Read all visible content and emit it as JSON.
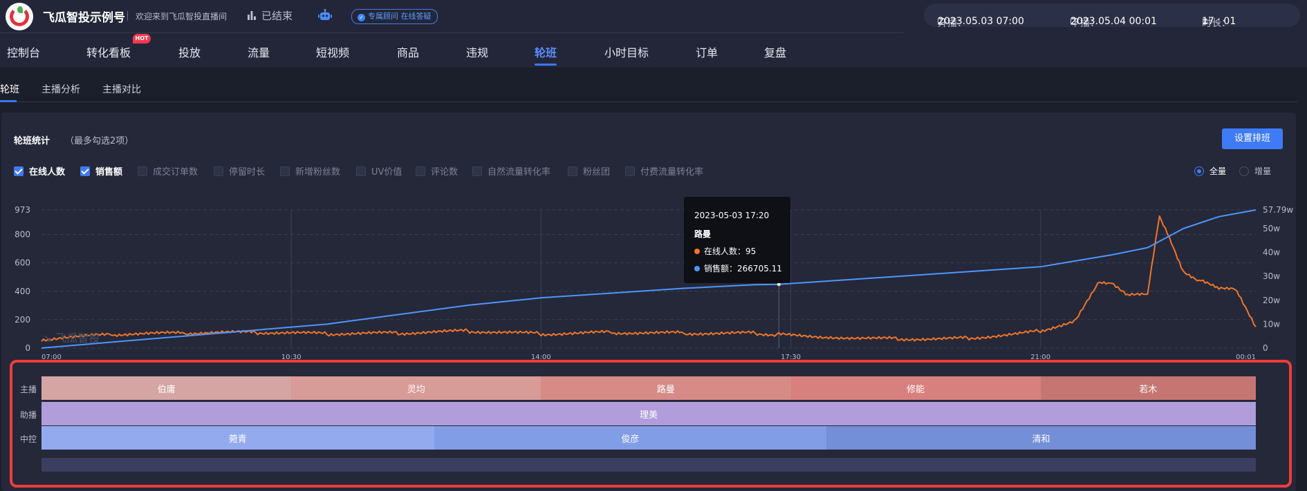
{
  "header": {
    "brand": "飞瓜智投示例号",
    "welcome": "欢迎来到飞瓜智投直播间",
    "status": "已结束",
    "consult": "专属顾问 在线答疑",
    "start_label": "开播：",
    "start_time": "2023.05.03 07:00",
    "end_label": "下播：",
    "end_time": "2023.05.04 00:01",
    "duration_label": "时长：",
    "duration": "17 : 01"
  },
  "nav": {
    "items": [
      "控制台",
      "转化看板",
      "投放",
      "流量",
      "短视频",
      "商品",
      "违规",
      "轮班",
      "小时目标",
      "订单",
      "复盘"
    ],
    "hot_badge": "HOT",
    "active": "轮班"
  },
  "subtabs": {
    "items": [
      "轮班",
      "主播分析",
      "主播对比"
    ]
  },
  "panel": {
    "title": "轮班统计",
    "hint": "（最多勾选2项）",
    "button": "设置排班",
    "metrics": [
      {
        "label": "在线人数",
        "checked": true
      },
      {
        "label": "销售额",
        "checked": true
      },
      {
        "label": "成交订单数",
        "checked": false
      },
      {
        "label": "停留时长",
        "checked": false
      },
      {
        "label": "新增粉丝数",
        "checked": false
      },
      {
        "label": "UV价值",
        "checked": false
      },
      {
        "label": "评论数",
        "checked": false
      },
      {
        "label": "自然流量转化率",
        "checked": false
      },
      {
        "label": "粉丝团",
        "checked": false
      },
      {
        "label": "付费流量转化率",
        "checked": false
      }
    ],
    "mode_all": "全量",
    "mode_inc": "增量",
    "watermark": "飞瓜智投"
  },
  "chart_data": {
    "type": "line",
    "x_ticks": [
      "07:00",
      "10:30",
      "14:00",
      "17:30",
      "21:00",
      "00:01"
    ],
    "y_left_ticks": [
      "0",
      "200",
      "400",
      "600",
      "800",
      "973"
    ],
    "y_right_ticks": [
      "0",
      "10w",
      "20w",
      "30w",
      "40w",
      "50w",
      "57.79w"
    ],
    "y_left_range": [
      0,
      973
    ],
    "y_right_range": [
      0,
      577900
    ],
    "series": [
      {
        "name": "在线人数",
        "axis": "left",
        "color": "#f07628",
        "x": [
          "07:00",
          "08:00",
          "09:00",
          "10:00",
          "11:00",
          "12:00",
          "13:00",
          "14:00",
          "15:00",
          "16:00",
          "17:00",
          "17:20",
          "18:00",
          "19:00",
          "20:00",
          "21:00",
          "21:30",
          "21:50",
          "22:00",
          "22:15",
          "22:30",
          "22:40",
          "22:50",
          "23:00",
          "23:15",
          "23:30",
          "23:45",
          "00:01"
        ],
        "values": [
          60,
          95,
          105,
          110,
          100,
          105,
          120,
          100,
          110,
          105,
          105,
          95,
          80,
          65,
          70,
          120,
          200,
          470,
          460,
          370,
          380,
          930,
          750,
          540,
          470,
          420,
          410,
          150
        ]
      },
      {
        "name": "销售额",
        "axis": "right",
        "color": "#4e96ff",
        "x": [
          "07:00",
          "08:00",
          "09:00",
          "10:00",
          "11:00",
          "12:00",
          "13:00",
          "14:00",
          "15:00",
          "16:00",
          "17:00",
          "17:20",
          "18:00",
          "19:00",
          "20:00",
          "21:00",
          "22:00",
          "22:30",
          "23:00",
          "23:30",
          "00:01"
        ],
        "values": [
          0,
          25000,
          50000,
          75000,
          100000,
          140000,
          180000,
          210000,
          230000,
          250000,
          265000,
          266705,
          280000,
          300000,
          320000,
          340000,
          390000,
          420000,
          500000,
          550000,
          577900
        ]
      }
    ],
    "tooltip": {
      "time": "2023-05-03 17:20",
      "anchor": "路曼",
      "online_label": "在线人数",
      "online_value": "95",
      "sales_label": "销售额",
      "sales_value": "266705.11"
    }
  },
  "schedule": {
    "rows": [
      {
        "label": "主播",
        "segments": [
          {
            "name": "伯庸",
            "start": "07:00",
            "end": "10:30",
            "color": "#d4a5a3"
          },
          {
            "name": "灵均",
            "start": "10:30",
            "end": "14:00",
            "color": "#d79b98"
          },
          {
            "name": "路曼",
            "start": "14:00",
            "end": "17:30",
            "color": "#d68b86"
          },
          {
            "name": "修能",
            "start": "17:30",
            "end": "21:00",
            "color": "#d8807d"
          },
          {
            "name": "若木",
            "start": "21:00",
            "end": "00:01",
            "color": "#c57672"
          }
        ]
      },
      {
        "label": "助播",
        "segments": [
          {
            "name": "理美",
            "start": "07:00",
            "end": "00:01",
            "color": "#b09dd9"
          }
        ]
      },
      {
        "label": "中控",
        "segments": [
          {
            "name": "菀青",
            "start": "07:00",
            "end": "12:30",
            "color": "#93aaef"
          },
          {
            "name": "俊彦",
            "start": "12:30",
            "end": "18:00",
            "color": "#819de6"
          },
          {
            "name": "清和",
            "start": "18:00",
            "end": "00:01",
            "color": "#728fd8"
          }
        ]
      }
    ]
  }
}
